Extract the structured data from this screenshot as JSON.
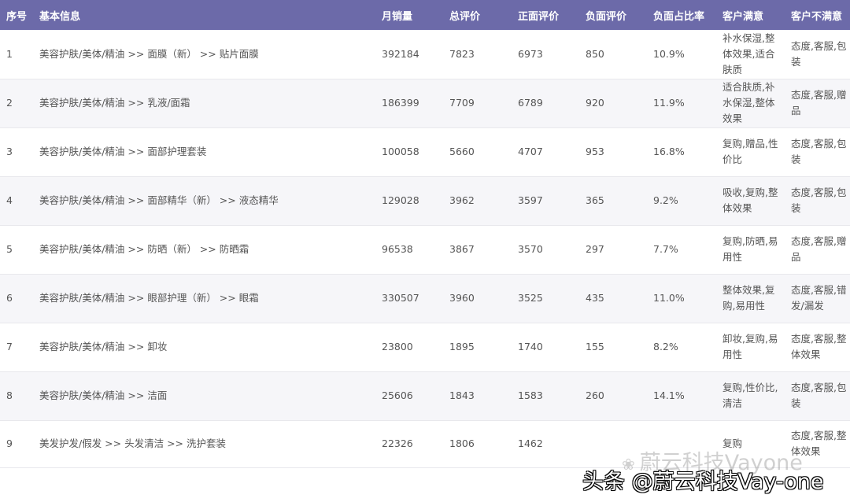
{
  "table": {
    "headers": {
      "index": "序号",
      "info": "基本信息",
      "monthly_sales": "月销量",
      "total_reviews": "总评价",
      "positive_reviews": "正面评价",
      "negative_reviews": "负面评价",
      "negative_ratio": "负面占比率",
      "satisfied": "客户满意",
      "dissatisfied": "客户不满意"
    },
    "rows": [
      {
        "index": "1",
        "info": "美容护肤/美体/精油 >> 面膜（新） >> 贴片面膜",
        "monthly_sales": "392184",
        "total_reviews": "7823",
        "positive_reviews": "6973",
        "negative_reviews": "850",
        "negative_ratio": "10.9%",
        "satisfied": "补水保湿,整体效果,适合肤质",
        "dissatisfied": "态度,客服,包装"
      },
      {
        "index": "2",
        "info": "美容护肤/美体/精油 >> 乳液/面霜",
        "monthly_sales": "186399",
        "total_reviews": "7709",
        "positive_reviews": "6789",
        "negative_reviews": "920",
        "negative_ratio": "11.9%",
        "satisfied": "适合肤质,补水保湿,整体效果",
        "dissatisfied": "态度,客服,赠品"
      },
      {
        "index": "3",
        "info": "美容护肤/美体/精油 >> 面部护理套装",
        "monthly_sales": "100058",
        "total_reviews": "5660",
        "positive_reviews": "4707",
        "negative_reviews": "953",
        "negative_ratio": "16.8%",
        "satisfied": "复购,赠品,性价比",
        "dissatisfied": "态度,客服,包装"
      },
      {
        "index": "4",
        "info": "美容护肤/美体/精油 >> 面部精华（新） >> 液态精华",
        "monthly_sales": "129028",
        "total_reviews": "3962",
        "positive_reviews": "3597",
        "negative_reviews": "365",
        "negative_ratio": "9.2%",
        "satisfied": "吸收,复购,整体效果",
        "dissatisfied": "态度,客服,包装"
      },
      {
        "index": "5",
        "info": "美容护肤/美体/精油 >> 防晒（新） >> 防晒霜",
        "monthly_sales": "96538",
        "total_reviews": "3867",
        "positive_reviews": "3570",
        "negative_reviews": "297",
        "negative_ratio": "7.7%",
        "satisfied": "复购,防晒,易用性",
        "dissatisfied": "态度,客服,赠品"
      },
      {
        "index": "6",
        "info": "美容护肤/美体/精油 >> 眼部护理（新） >> 眼霜",
        "monthly_sales": "330507",
        "total_reviews": "3960",
        "positive_reviews": "3525",
        "negative_reviews": "435",
        "negative_ratio": "11.0%",
        "satisfied": "整体效果,复购,易用性",
        "dissatisfied": "态度,客服,错发/漏发"
      },
      {
        "index": "7",
        "info": "美容护肤/美体/精油 >> 卸妆",
        "monthly_sales": "23800",
        "total_reviews": "1895",
        "positive_reviews": "1740",
        "negative_reviews": "155",
        "negative_ratio": "8.2%",
        "satisfied": "卸妆,复购,易用性",
        "dissatisfied": "态度,客服,整体效果"
      },
      {
        "index": "8",
        "info": "美容护肤/美体/精油 >> 洁面",
        "monthly_sales": "25606",
        "total_reviews": "1843",
        "positive_reviews": "1583",
        "negative_reviews": "260",
        "negative_ratio": "14.1%",
        "satisfied": "复购,性价比,清洁",
        "dissatisfied": "态度,客服,包装"
      },
      {
        "index": "9",
        "info": "美发护发/假发 >> 头发清洁 >> 洗护套装",
        "monthly_sales": "22326",
        "total_reviews": "1806",
        "positive_reviews": "1462",
        "negative_reviews": "",
        "negative_ratio": "",
        "satisfied": "复购",
        "dissatisfied": "态度,客服,整体效果"
      }
    ]
  },
  "watermark": {
    "light_text": "蔚云科技Vayone",
    "main_text": "头条 @蔚云科技Vay-one"
  }
}
